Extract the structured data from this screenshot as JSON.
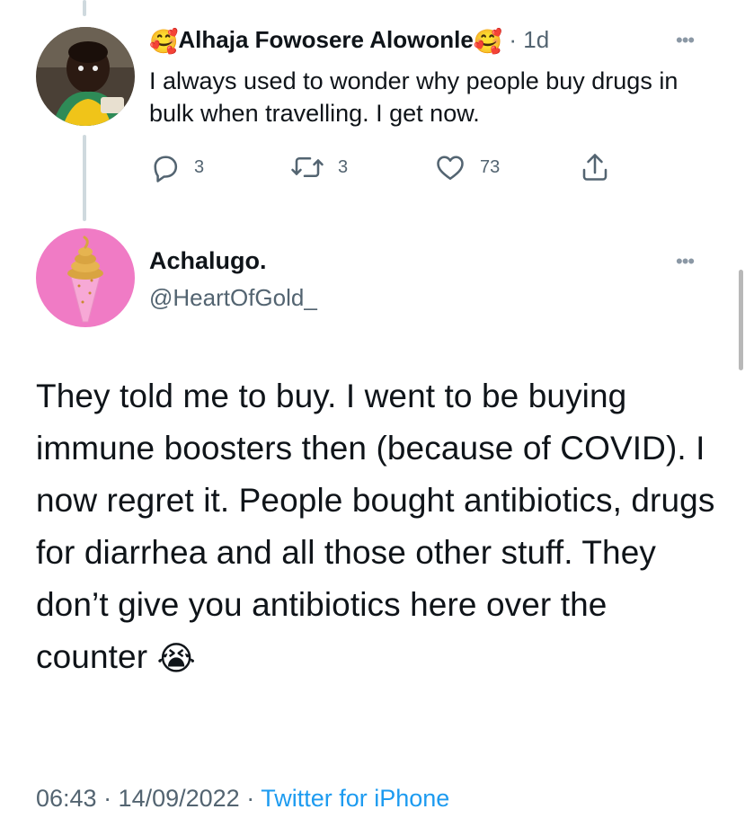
{
  "parent": {
    "name": "Alhaja Fowosere Alowonle",
    "name_emoji": "🥰",
    "time": "· 1d",
    "text": "I always used to wonder why people buy drugs in bulk when travelling. I get now.",
    "replies": "3",
    "retweets": "3",
    "likes": "73",
    "more": "•••"
  },
  "main": {
    "name": "Achalugo.",
    "handle": "@HeartOfGold_",
    "text": "They told me to buy. I went to be buying immune boosters then (because of COVID). I now regret it. People bought antibiotics, drugs for diarrhea and all those other stuff. They don’t give you antibiotics here over the counter",
    "text_emoji": "😭",
    "more": "•••",
    "meta": "06:43 · 14/09/2022 · ",
    "source": "Twitter for iPhone"
  },
  "colors": {
    "accent": "#1d9bf0",
    "muted": "#536471",
    "thread_line": "#cfd9de",
    "avatar_pink": "#f07bc5"
  },
  "icons": {
    "reply": "reply-icon",
    "retweet": "retweet-icon",
    "like": "heart-icon",
    "share": "share-icon",
    "more": "more-icon"
  }
}
